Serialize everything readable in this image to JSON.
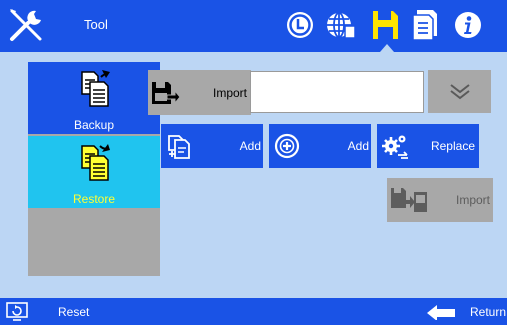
{
  "topbar": {
    "title": "Tool",
    "icons": [
      "clock-icon",
      "globe-icon",
      "save-icon",
      "document-icon",
      "info-icon"
    ],
    "active_icon": "save-icon"
  },
  "sidebar": {
    "items": [
      {
        "label": "Backup",
        "icon": "backup-documents-icon",
        "selected": false
      },
      {
        "label": "Restore",
        "icon": "restore-documents-icon",
        "selected": true
      }
    ]
  },
  "main": {
    "import_label": "Import",
    "import_value": "",
    "dropdown_icon": "double-chevron-down-icon",
    "actions": [
      {
        "label": "Add",
        "icon": "document-add-icon"
      },
      {
        "label": "Add",
        "icon": "circle-plus-icon"
      },
      {
        "label": "Replace",
        "icon": "gears-replace-icon"
      }
    ],
    "import2_label": "Import"
  },
  "bottombar": {
    "reset_label": "Reset",
    "return_label": "Return"
  },
  "colors": {
    "bar_blue": "#1a53e6",
    "background": "#bcd6f4",
    "restore_cyan": "#20c4ef",
    "restore_text": "#ffff33",
    "disabled_gray": "#a8a8a8",
    "save_icon_yellow": "#ffe400"
  }
}
